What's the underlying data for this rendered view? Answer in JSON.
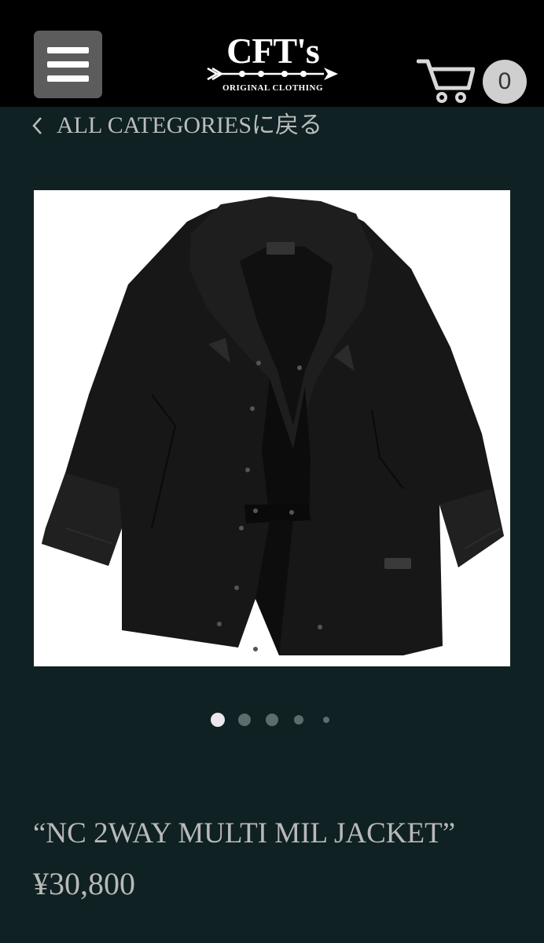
{
  "header": {
    "menu_icon": "hamburger-menu-icon",
    "logo": {
      "title": "CFT's",
      "subtitle": "ORIGINAL CLOTHING"
    },
    "cart": {
      "icon": "cart-icon",
      "count": "0"
    }
  },
  "breadcrumb": {
    "icon": "chevron-left-icon",
    "label": "ALL CATEGORIESに戻る"
  },
  "gallery": {
    "image_subject": "black hooded military jacket on white background",
    "total_slides": 5,
    "active_slide": 1
  },
  "product": {
    "name": "“NC 2WAY MULTI MIL JACKET”",
    "price": "¥30,800"
  },
  "colors": {
    "background": "#0f2122",
    "header": "#000000",
    "text": "#b9b9b9",
    "menu_button": "#5c5c5c",
    "active_dot": "#ece6ee",
    "inactive_dot": "#5a6e6e"
  }
}
